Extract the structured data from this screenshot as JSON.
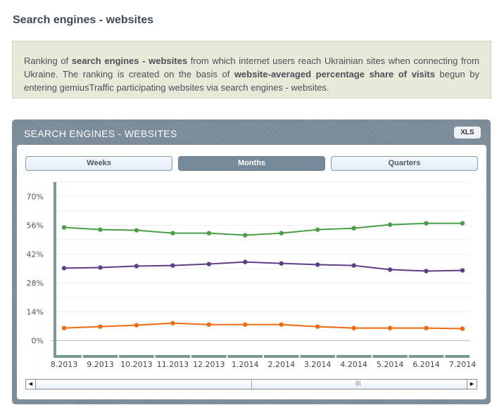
{
  "page": {
    "title": "Search engines - websites"
  },
  "info": {
    "segments": [
      {
        "text": "Ranking of ",
        "bold": false
      },
      {
        "text": "search engines - websites",
        "bold": true
      },
      {
        "text": " from which internet users reach Ukrainian sites when connecting from Ukraine. The ranking is created on the basis of ",
        "bold": false
      },
      {
        "text": "website-averaged percentage share of visits",
        "bold": true
      },
      {
        "text": " begun by entering gemiusTraffic participating websites via search engines - websites.",
        "bold": false
      }
    ]
  },
  "panel": {
    "title": "SEARCH ENGINES - WEBSITES",
    "xls_label": "XLS"
  },
  "tabs": [
    {
      "label": "Weeks",
      "active": false
    },
    {
      "label": "Months",
      "active": true
    },
    {
      "label": "Quarters",
      "active": false
    }
  ],
  "chart_data": {
    "type": "line",
    "categories": [
      "8.2013",
      "9.2013",
      "10.2013",
      "11.2013",
      "12.2013",
      "1.2014",
      "2.2014",
      "3.2014",
      "4.2014",
      "5.2014",
      "6.2014",
      "7.2014"
    ],
    "yticks": [
      0,
      14,
      28,
      42,
      56,
      70
    ],
    "ytick_labels": [
      "0%",
      "14%",
      "28%",
      "42%",
      "56%",
      "70%"
    ],
    "ylim": [
      -7,
      77
    ],
    "grid": true,
    "series": [
      {
        "name": "series-green",
        "color": "#4a9e48",
        "values": [
          55.0,
          53.9,
          53.6,
          52.2,
          52.2,
          51.2,
          52.2,
          53.9,
          54.6,
          56.3,
          57.0,
          57.0
        ]
      },
      {
        "name": "series-purple",
        "color": "#5e3f86",
        "values": [
          35.2,
          35.5,
          36.2,
          36.5,
          37.2,
          38.2,
          37.5,
          36.9,
          36.5,
          34.5,
          33.8,
          34.1
        ]
      },
      {
        "name": "series-orange",
        "color": "#f06a10",
        "values": [
          6.1,
          6.8,
          7.5,
          8.5,
          7.8,
          7.8,
          7.8,
          6.8,
          6.1,
          6.1,
          6.1,
          5.8
        ]
      }
    ]
  }
}
